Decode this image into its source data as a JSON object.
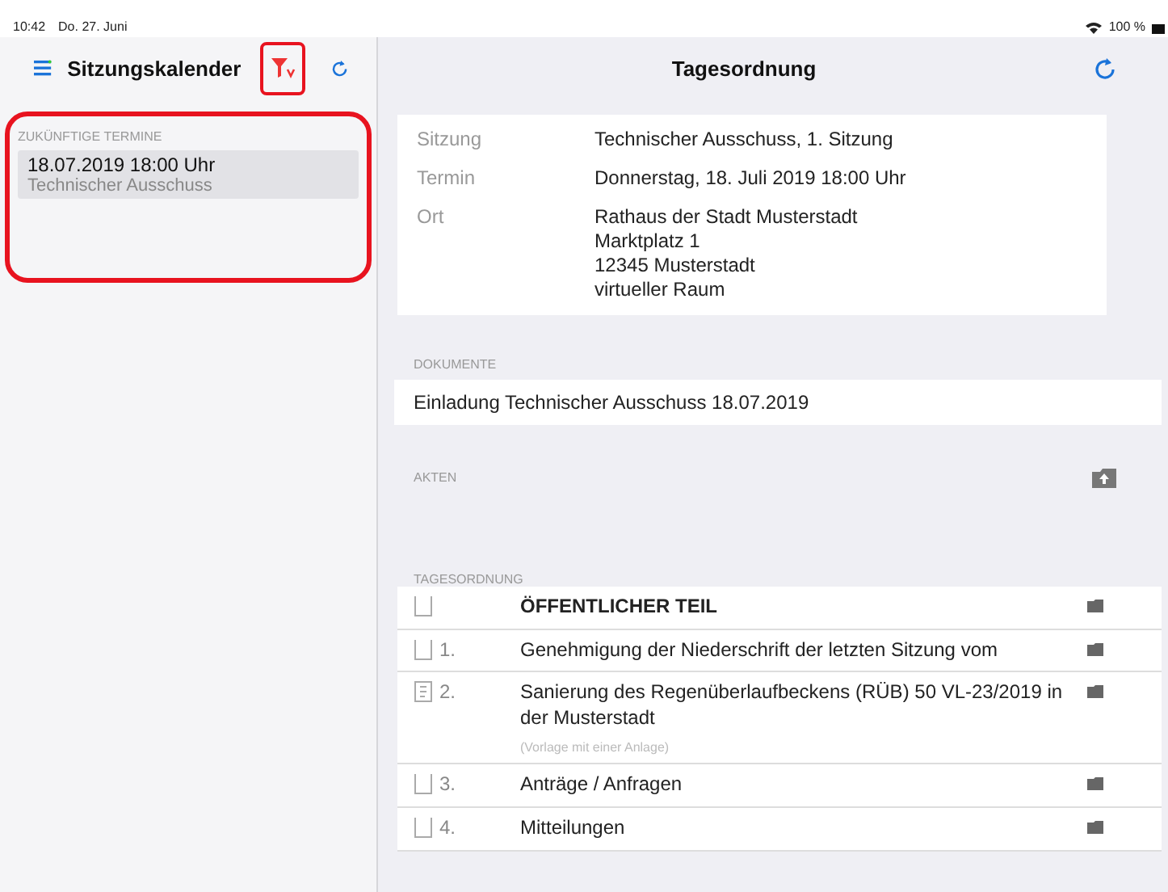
{
  "status_bar": {
    "time": "10:42",
    "date": "Do. 27. Juni",
    "battery": "100 %"
  },
  "sidebar": {
    "title": "Sitzungskalender",
    "filter_highlighted": true,
    "section": {
      "header": "ZUKÜNFTIGE TERMINE",
      "highlighted": true,
      "items": [
        {
          "date": "18.07.2019 18:00 Uhr",
          "name": "Technischer Ausschuss",
          "selected": true
        }
      ]
    }
  },
  "main": {
    "title": "Tagesordnung",
    "details": [
      {
        "label": "Sitzung",
        "lines": [
          "Technischer Ausschuss, 1. Sitzung"
        ]
      },
      {
        "label": "Termin",
        "lines": [
          "Donnerstag, 18. Juli 2019 18:00 Uhr"
        ]
      },
      {
        "label": "Ort",
        "lines": [
          "Rathaus der Stadt Musterstadt",
          "Marktplatz 1",
          "12345 Musterstadt",
          "virtueller Raum"
        ]
      }
    ],
    "documents": {
      "header": "DOKUMENTE",
      "items": [
        "Einladung Technischer Ausschuss 18.07.2019"
      ]
    },
    "files": {
      "header": "AKTEN"
    },
    "agenda": {
      "header": "TAGESORDNUNG",
      "items": [
        {
          "kind": "section",
          "title": "ÖFFENTLICHER TEIL",
          "has_document": false
        },
        {
          "kind": "item",
          "number": "1.",
          "title": "Genehmigung der Niederschrift der letzten Sitzung vom",
          "has_document": false
        },
        {
          "kind": "item",
          "number": "2.",
          "title": "Sanierung des Regenüberlaufbeckens (RÜB) 50  VL-23/2019 in der Musterstadt",
          "subtitle": "(Vorlage mit einer Anlage)",
          "has_document": true
        },
        {
          "kind": "item",
          "number": "3.",
          "title": "Anträge / Anfragen",
          "has_document": false
        },
        {
          "kind": "item",
          "number": "4.",
          "title": "Mitteilungen",
          "has_document": false
        }
      ]
    }
  }
}
